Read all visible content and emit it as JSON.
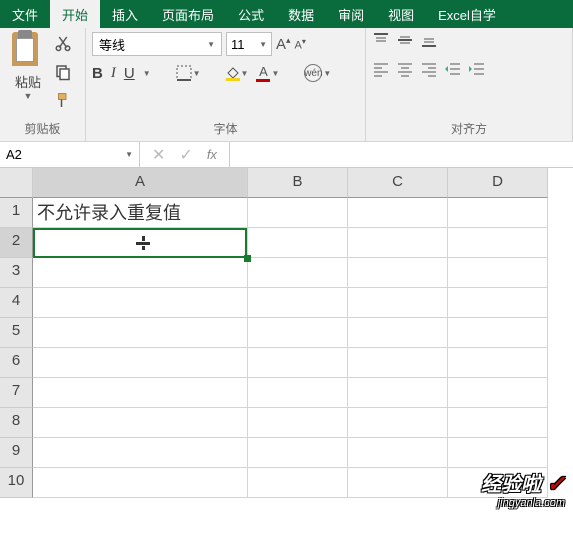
{
  "tabs": {
    "file": "文件",
    "home": "开始",
    "insert": "插入",
    "layout": "页面布局",
    "formula": "公式",
    "data": "数据",
    "review": "审阅",
    "view": "视图",
    "custom": "Excel自学"
  },
  "clipboard": {
    "paste": "粘贴",
    "group_label": "剪贴板"
  },
  "font": {
    "name": "等线",
    "size": "11",
    "bold": "B",
    "italic": "I",
    "underline": "U",
    "font_a": "A",
    "wen": "wén",
    "group_label": "字体"
  },
  "align": {
    "group_label": "对齐方"
  },
  "namebox": "A2",
  "fx": "fx",
  "columns": {
    "A": "A",
    "B": "B",
    "C": "C",
    "D": "D"
  },
  "rows": [
    "1",
    "2",
    "3",
    "4",
    "5",
    "6",
    "7",
    "8",
    "9",
    "10"
  ],
  "cells": {
    "A1": "不允许录入重复值"
  },
  "active_cell": "A2",
  "watermark": {
    "line1": "经验啦",
    "check": "✓",
    "line2": "jingyanla.com"
  }
}
